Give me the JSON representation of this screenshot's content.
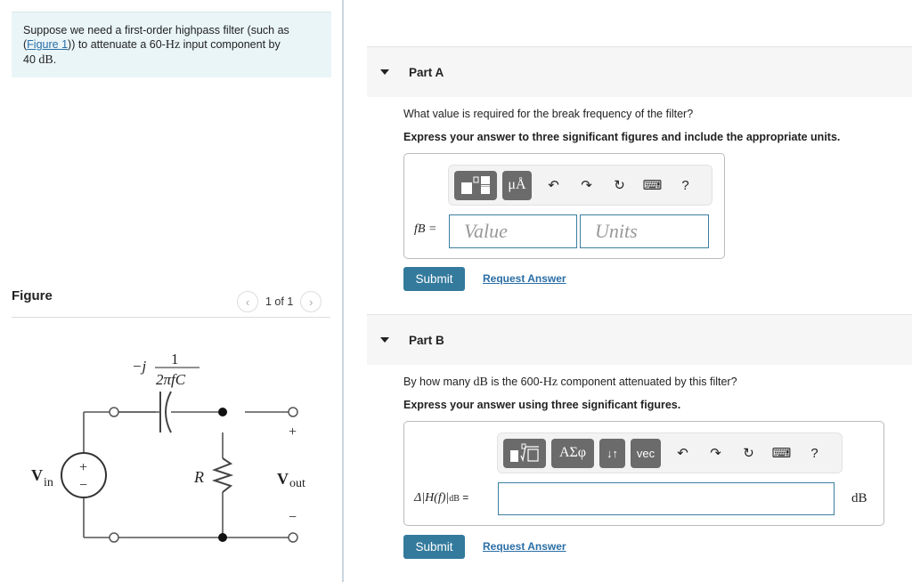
{
  "problem": {
    "text_before": "Suppose we need a first-order highpass filter (such as (",
    "figure_link": "Figure 1",
    "text_middle": ")) to attenuate a 60-",
    "unit_hz": "Hz",
    "text_after": " input component by",
    "value_40": "40 ",
    "unit_db": "dB",
    "period": "."
  },
  "figure": {
    "title": "Figure",
    "pager": {
      "prev_icon": "‹",
      "text": "1 of 1",
      "next_icon": "›"
    },
    "circuit": {
      "impedance_prefix": "−j",
      "impedance_num": "1",
      "impedance_den": "2πfC",
      "resistor": "R",
      "vin": "V",
      "vin_sub": "in",
      "vout": "V",
      "vout_sub": "out",
      "plus": "+",
      "minus": "−"
    }
  },
  "part_a": {
    "label": "Part A",
    "question": "What value is required for the break frequency of the filter?",
    "instruction": "Express your answer to three significant figures and include the appropriate units.",
    "toolbar": {
      "template_icon": "templates",
      "units_label": "μÅ",
      "undo_icon": "↶",
      "redo_icon": "↷",
      "reset_icon": "↻",
      "keyboard_icon": "⌨",
      "help_label": "?"
    },
    "eq_label": "fB =",
    "value_placeholder": "Value",
    "units_placeholder": "Units",
    "submit_label": "Submit",
    "request_label": "Request Answer"
  },
  "part_b": {
    "label": "Part B",
    "question_before": "By how many ",
    "question_db": "dB",
    "question_middle": " is the 600-",
    "question_hz": "Hz",
    "question_after": " component attenuated by this filter?",
    "instruction": "Express your answer using three significant figures.",
    "toolbar": {
      "template_icon": "templates",
      "greek_label": "ΑΣφ",
      "arrows_label": "↓↑",
      "vec_label": "vec",
      "undo_icon": "↶",
      "redo_icon": "↷",
      "reset_icon": "↻",
      "keyboard_icon": "⌨",
      "help_label": "?"
    },
    "eq_label": "Δ|H(f)|",
    "eq_sub": "dB",
    "eq_equals": " =",
    "answer_value": "",
    "unit": "dB",
    "submit_label": "Submit",
    "request_label": "Request Answer"
  }
}
